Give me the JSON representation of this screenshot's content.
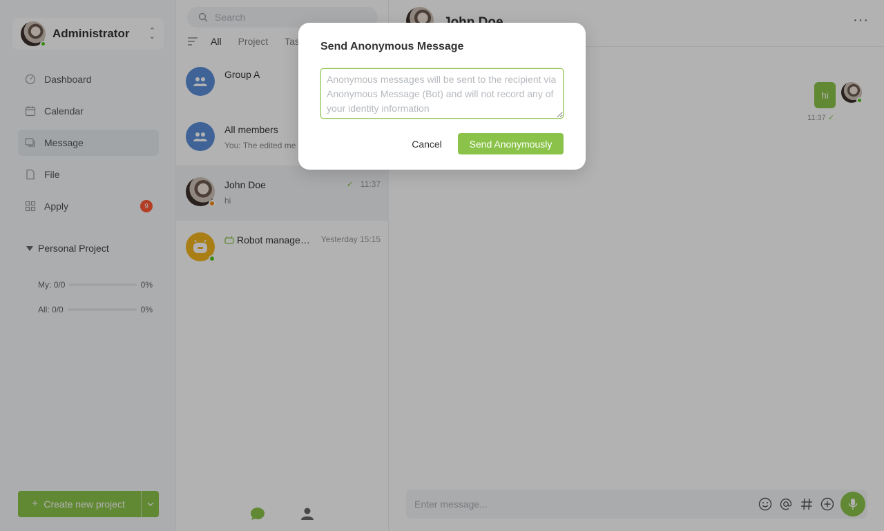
{
  "sidebar": {
    "user": {
      "name": "Administrator",
      "status": "online"
    },
    "nav": [
      {
        "label": "Dashboard",
        "icon": "dashboard-icon"
      },
      {
        "label": "Calendar",
        "icon": "calendar-icon"
      },
      {
        "label": "Message",
        "icon": "message-icon",
        "active": true
      },
      {
        "label": "File",
        "icon": "file-icon"
      },
      {
        "label": "Apply",
        "icon": "apps-icon",
        "badge": "9"
      }
    ],
    "project": {
      "title": "Personal Project",
      "my_label": "My:",
      "my_value": "0/0",
      "my_percent": "0%",
      "my_progress": 0,
      "all_label": "All:",
      "all_value": "0/0",
      "all_percent": "0%",
      "all_progress": 0
    },
    "create_label": "Create new project"
  },
  "conversations": {
    "search_placeholder": "Search",
    "tabs": [
      "All",
      "Project",
      "Tas"
    ],
    "items": [
      {
        "title": "Group A",
        "subtitle": "",
        "time": ""
      },
      {
        "title": "All members",
        "subtitle": "You: The edited me",
        "time": ""
      },
      {
        "title": "John Doe",
        "subtitle": "hi",
        "time": "11:37"
      },
      {
        "title": "Robot manage…",
        "subtitle": "",
        "time": "Yesterday 15:15"
      }
    ]
  },
  "chat": {
    "contact_name": "John Doe",
    "message_text": "hi",
    "message_time": "11:37",
    "input_placeholder": "Enter message..."
  },
  "dialog": {
    "title": "Send Anonymous Message",
    "placeholder": "Anonymous messages will be sent to the recipient via Anonymous Message (Bot) and will not record any of your identity information",
    "cancel_label": "Cancel",
    "send_label": "Send Anonymously"
  },
  "colors": {
    "accent": "#8bc34a",
    "badge": "#ff5a35",
    "group_avatar": "#5b8fd8",
    "robot_avatar": "#f2b51f"
  }
}
